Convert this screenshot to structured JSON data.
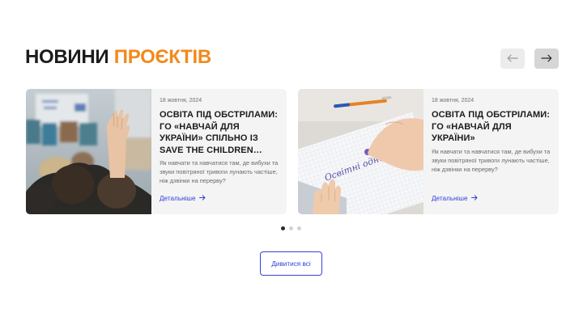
{
  "header": {
    "title_part1": "НОВИНИ",
    "title_part2": "ПРОЄКТІВ",
    "prev_icon": "arrow-left-icon",
    "next_icon": "arrow-right-icon"
  },
  "cards": [
    {
      "date": "18 жовтня, 2024",
      "title": "ОСВІТА ПІД ОБСТРІЛАМИ: ГО «НАВЧАЙ ДЛЯ УКРАЇНИ» СПІЛЬНО ІЗ SAVE THE CHILDREN…",
      "description": "Як навчати та навчатися там, де вибухи та звуки повітряної тривоги лунають частіше, ніж дзвінки на перерву?",
      "link_label": "Детальніше",
      "image": "classroom-raised-hand-photo"
    },
    {
      "date": "18 жовтня, 2024",
      "title": "ОСВІТА ПІД ОБСТРІЛАМИ: ГО «НАВЧАЙ ДЛЯ УКРАЇНИ»",
      "description": "Як навчати та навчатися там, де вибухи та звуки повітряної тривоги лунають частіше, ніж дзвінки на перерву?",
      "link_label": "Детальніше",
      "image": "writing-notebook-photo"
    }
  ],
  "pagination": {
    "total": 3,
    "active": 1
  },
  "view_all_label": "Дивитися всі",
  "colors": {
    "accent": "#f08a1c",
    "link": "#2f3fd6",
    "card_bg": "#f4f4f4"
  }
}
